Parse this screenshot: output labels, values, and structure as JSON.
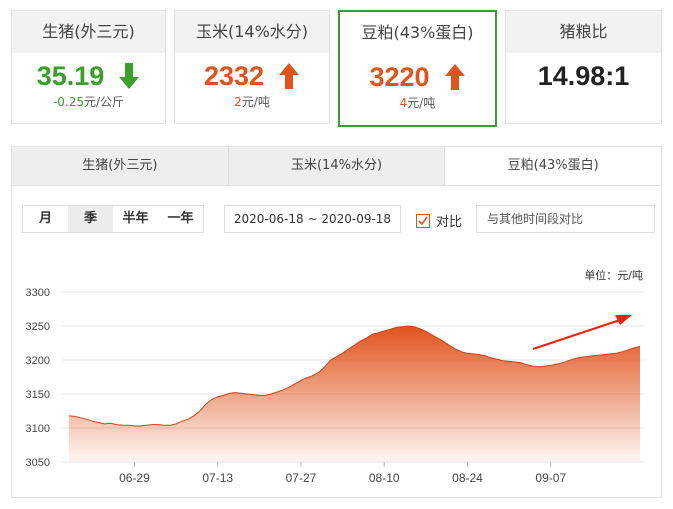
{
  "cards": [
    {
      "title": "生猪(外三元)",
      "value": "35.19",
      "change_num": "-0.25",
      "change_unit": "元/公斤",
      "trend": "down",
      "color": "#3aa02a"
    },
    {
      "title": "玉米(14%水分)",
      "value": "2332",
      "change_num": "2",
      "change_unit": "元/吨",
      "trend": "up",
      "color": "#e0531d"
    },
    {
      "title": "豆粕(43%蛋白)",
      "value": "3220",
      "change_num": "4",
      "change_unit": "元/吨",
      "trend": "up",
      "color": "#e0531d"
    },
    {
      "title": "猪粮比",
      "value": "14.98:1"
    }
  ],
  "tabs": [
    "生猪(外三元)",
    "玉米(14%水分)",
    "豆粕(43%蛋白)"
  ],
  "active_tab": "豆粕(43%蛋白)",
  "periods": [
    "月",
    "季",
    "半年",
    "一年"
  ],
  "active_period": "季",
  "date_range": "2020-06-18 ~ 2020-09-18",
  "compare_label": "对比",
  "compare_checked": true,
  "compare_placeholder": "与其他时间段对比",
  "unit_label": "单位：元/吨",
  "chart_data": {
    "type": "area",
    "title": "",
    "xlabel": "",
    "ylabel": "",
    "unit": "元/吨",
    "ylim": [
      3050,
      3300
    ],
    "yticks": [
      3050,
      3100,
      3150,
      3200,
      3250,
      3300
    ],
    "x_tick_labels": [
      "06-29",
      "07-13",
      "07-27",
      "08-10",
      "08-24",
      "09-07"
    ],
    "x_tick_indices": [
      11,
      25,
      39,
      53,
      67,
      81
    ],
    "grid": true,
    "color": "#e0531d",
    "series": [
      {
        "values": [
          3118,
          3117,
          3115,
          3113,
          3110,
          3108,
          3106,
          3107,
          3105,
          3104,
          3104,
          3103,
          3103,
          3104,
          3105,
          3105,
          3104,
          3104,
          3106,
          3110,
          3113,
          3118,
          3125,
          3135,
          3142,
          3146,
          3148,
          3151,
          3152,
          3151,
          3150,
          3149,
          3148,
          3148,
          3150,
          3153,
          3156,
          3160,
          3165,
          3170,
          3174,
          3177,
          3182,
          3190,
          3200,
          3205,
          3210,
          3216,
          3222,
          3228,
          3232,
          3238,
          3240,
          3243,
          3245,
          3248,
          3249,
          3250,
          3249,
          3246,
          3242,
          3237,
          3232,
          3227,
          3221,
          3216,
          3212,
          3210,
          3209,
          3208,
          3206,
          3203,
          3201,
          3199,
          3198,
          3197,
          3196,
          3193,
          3191,
          3190,
          3191,
          3192,
          3194,
          3196,
          3199,
          3202,
          3204,
          3205,
          3206,
          3207,
          3208,
          3209,
          3210,
          3212,
          3215,
          3218,
          3220
        ]
      }
    ]
  }
}
